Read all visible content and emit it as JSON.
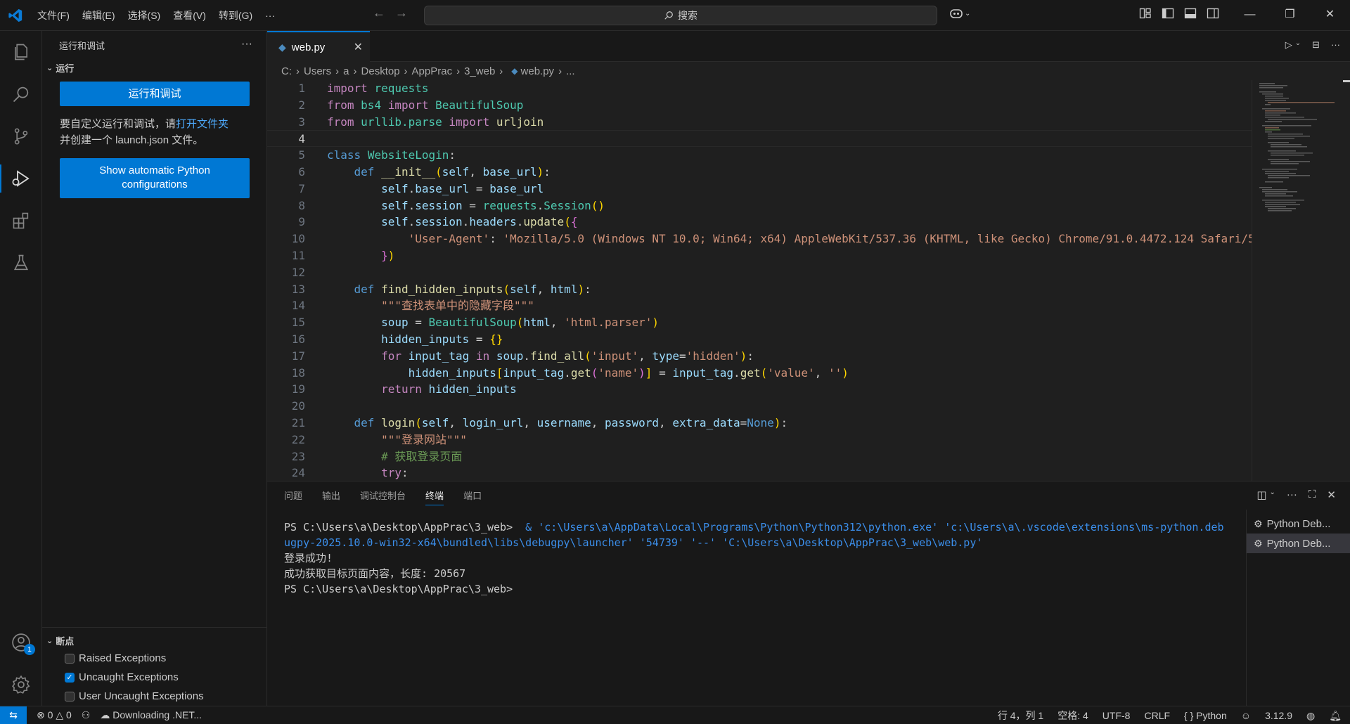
{
  "titlebar": {
    "menu": [
      "文件(F)",
      "编辑(E)",
      "选择(S)",
      "查看(V)",
      "转到(G)",
      "···"
    ],
    "search_label": "搜索"
  },
  "sidebar": {
    "title": "运行和调试",
    "section_run": "运行",
    "run_debug_button": "运行和调试",
    "info_prefix": "要自定义运行和调试，请",
    "info_link": "打开文件夹",
    "info_suffix": "并创建一个 launch.json 文件。",
    "python_config_button": "Show automatic Python configurations",
    "section_breakpoints": "断点",
    "breakpoints": [
      {
        "label": "Raised Exceptions",
        "checked": false
      },
      {
        "label": "Uncaught Exceptions",
        "checked": true
      },
      {
        "label": "User Uncaught Exceptions",
        "checked": false
      }
    ],
    "accounts_badge": "1"
  },
  "editor": {
    "tab_label": "web.py",
    "breadcrumb": [
      "C:",
      "Users",
      "a",
      "Desktop",
      "AppPrac",
      "3_web",
      "web.py",
      "..."
    ],
    "current_line": 4
  },
  "panel": {
    "tabs": [
      "问题",
      "输出",
      "调试控制台",
      "终端",
      "端口"
    ],
    "active_tab": "终端",
    "terminal": {
      "prompt1": "PS C:\\Users\\a\\Desktop\\AppPrac\\3_web> ",
      "cmd": " & 'c:\\Users\\a\\AppData\\Local\\Programs\\Python\\Python312\\python.exe' 'c:\\Users\\a\\.vscode\\extensions\\ms-python.debugpy-2025.10.0-win32-x64\\bundled\\libs\\debugpy\\launcher' '54739' '--' 'C:\\Users\\a\\Desktop\\AppPrac\\3_web\\web.py'",
      "out1": "登录成功!",
      "out2": "成功获取目标页面内容，长度: 20567",
      "prompt2": "PS C:\\Users\\a\\Desktop\\AppPrac\\3_web>"
    },
    "terminal_list": [
      "Python Deb...",
      "Python Deb..."
    ]
  },
  "statusbar": {
    "errors": "0",
    "warnings": "0",
    "downloading": "Downloading .NET...",
    "position": "行 4，列 1",
    "spaces": "空格: 4",
    "encoding": "UTF-8",
    "eol": "CRLF",
    "language": "Python",
    "python_version": "3.12.9"
  },
  "colors": {
    "accent": "#0078d4",
    "background": "#1f1f1f",
    "sidebar": "#181818"
  }
}
